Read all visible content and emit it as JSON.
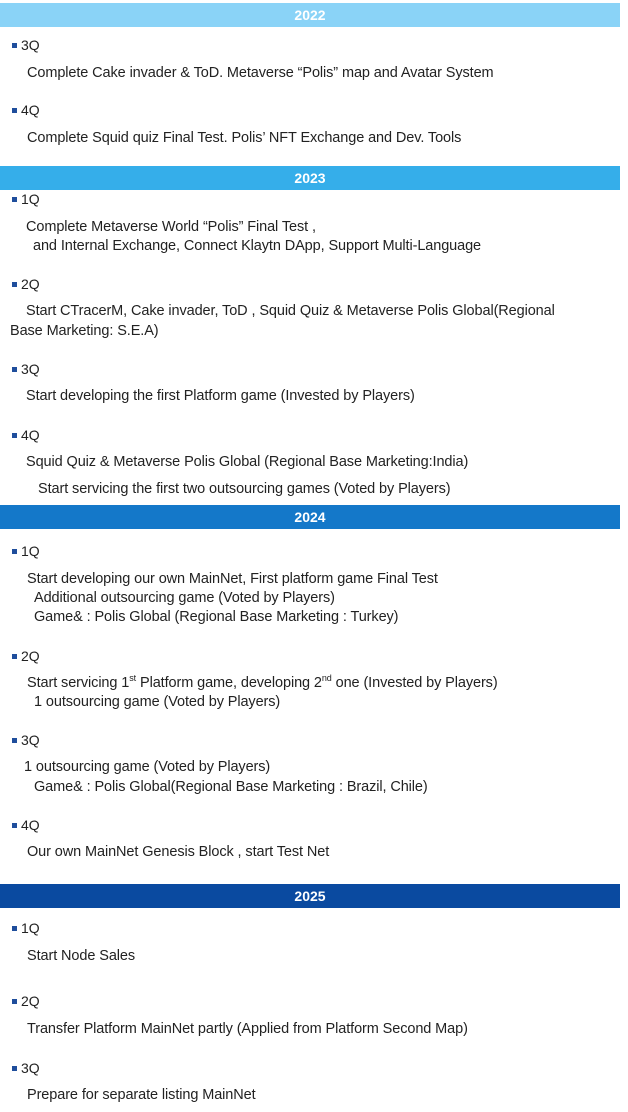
{
  "colors": {
    "band_2022": "#8ad3f7",
    "band_2023": "#35aeea",
    "band_2024": "#1478c9",
    "band_2025": "#0a4aa0",
    "bullet": "#1f4e9c"
  },
  "y2022": {
    "year": "2022",
    "q3": {
      "label": "3Q",
      "l1": "Complete Cake invader & ToD. Metaverse “Polis” map and Avatar System"
    },
    "q4": {
      "label": "4Q",
      "l1": "Complete Squid quiz Final Test.  Polis’ NFT Exchange and Dev. Tools"
    }
  },
  "y2023": {
    "year": "2023",
    "q1": {
      "label": "1Q",
      "l1": "Complete  Metaverse World “Polis” Final Test ,",
      "l2": "and Internal Exchange, Connect Klaytn DApp, Support Multi-Language"
    },
    "q2": {
      "label": "2Q",
      "l1": "Start CTracerM, Cake invader, ToD , Squid Quiz & Metaverse Polis Global(Regional",
      "l2": "Base Marketing: S.E.A)"
    },
    "q3": {
      "label": "3Q",
      "l1": "Start developing the first Platform game (Invested by Players)"
    },
    "q4": {
      "label": "4Q",
      "l1": "Squid Quiz & Metaverse Polis Global (Regional Base Marketing:India)",
      "l2": "Start servicing the first two outsourcing games (Voted by Players)"
    }
  },
  "y2024": {
    "year": "2024",
    "q1": {
      "label": "1Q",
      "l1": "Start developing our own MainNet, First platform game Final Test",
      "l2": "Additional outsourcing game (Voted by Players)",
      "l3": "Game& : Polis Global (Regional Base Marketing : Turkey)"
    },
    "q2": {
      "label": "2Q",
      "l1a": "Start servicing 1",
      "l1sup1": "st",
      "l1b": " Platform game, developing 2",
      "l1sup2": "nd",
      "l1c": " one   (Invested by Players)",
      "l2": "1 outsourcing game (Voted by Players)"
    },
    "q3": {
      "label": "3Q",
      "l1": "1 outsourcing game (Voted by Players)",
      "l2": "Game& : Polis Global(Regional Base Marketing : Brazil, Chile)"
    },
    "q4": {
      "label": "4Q",
      "l1": "Our own MainNet Genesis Block , start Test Net"
    }
  },
  "y2025": {
    "year": "2025",
    "q1": {
      "label": "1Q",
      "l1": "Start Node Sales"
    },
    "q2": {
      "label": "2Q",
      "l1": "Transfer Platform MainNet partly (Applied from Platform Second Map)"
    },
    "q3": {
      "label": "3Q",
      "l1": "Prepare for separate listing MainNet"
    }
  }
}
